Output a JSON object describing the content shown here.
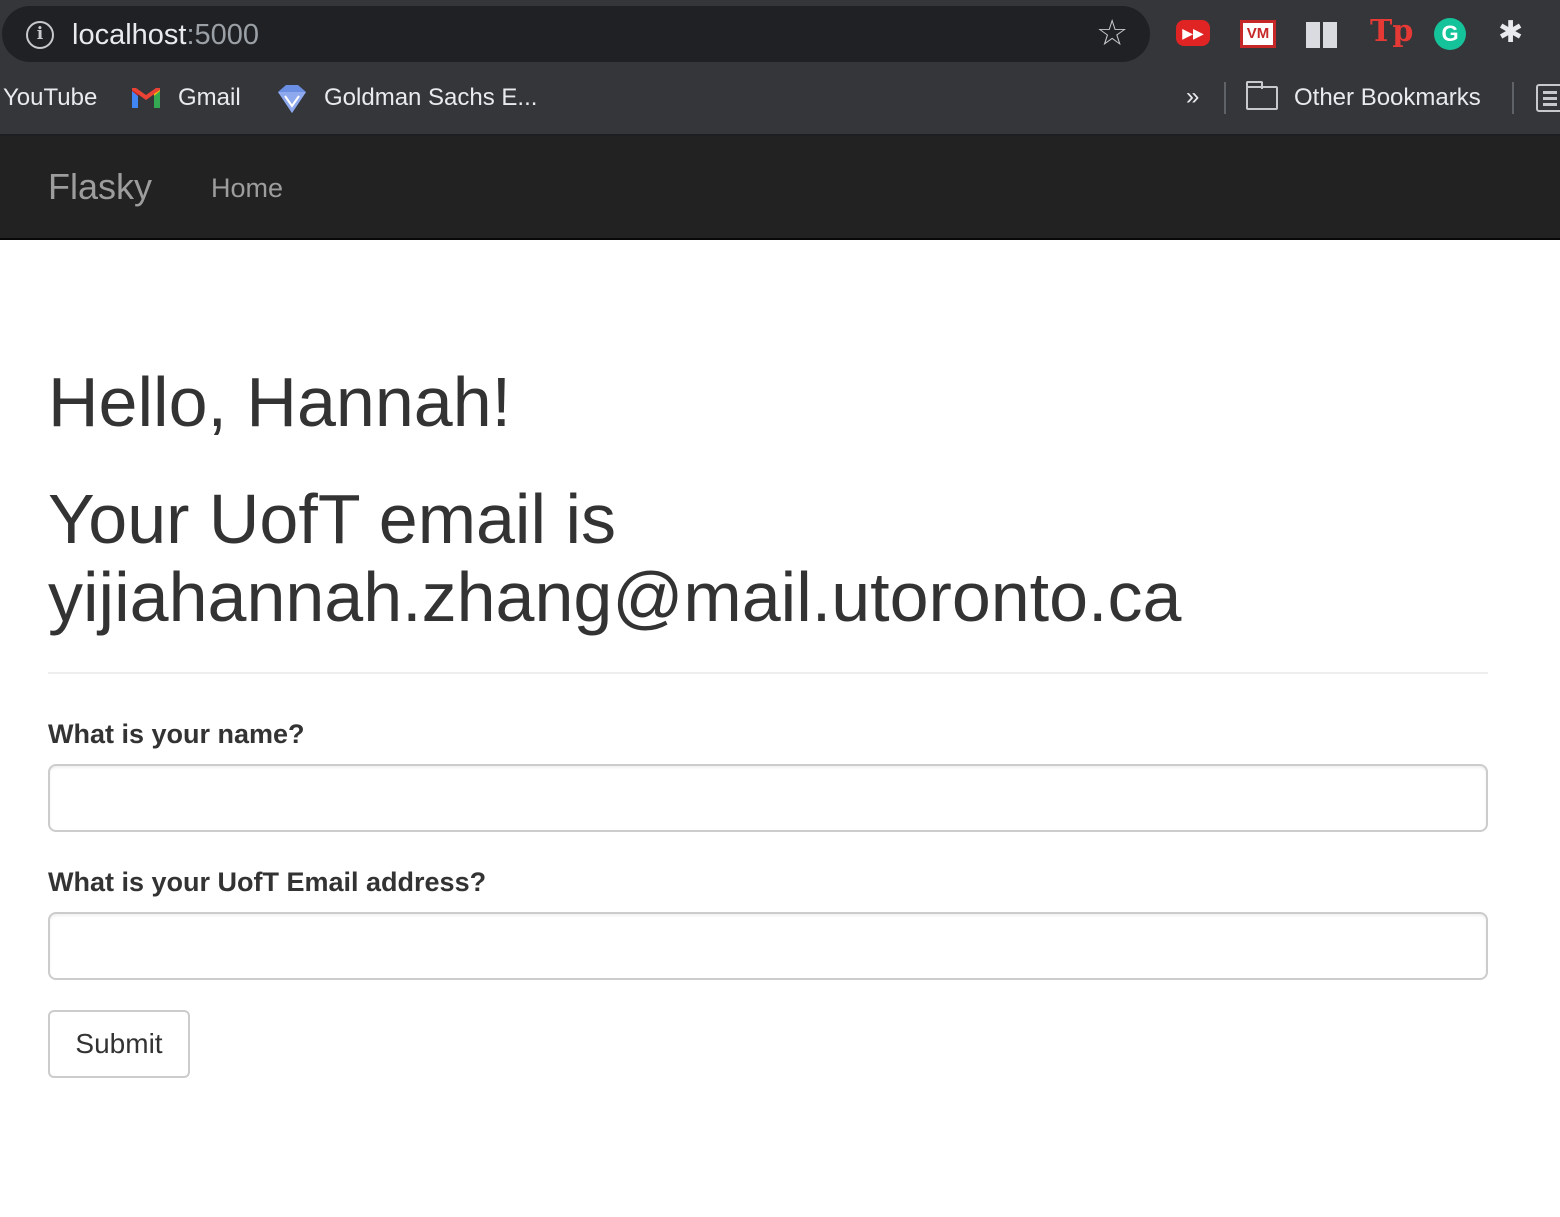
{
  "browser": {
    "url_host": "localhost",
    "url_port": ":5000",
    "bookmarks": {
      "youtube": "YouTube",
      "gmail": "Gmail",
      "goldman": "Goldman Sachs E...",
      "overflow": "»",
      "other": "Other Bookmarks"
    },
    "extensions": {
      "vm": "VM",
      "tp": "Tp",
      "grammarly": "G"
    }
  },
  "navbar": {
    "brand": "Flasky",
    "home": "Home"
  },
  "page": {
    "greeting": "Hello, Hannah!",
    "email_line": "Your UofT email is yijiahannah.zhang@mail.utoronto.ca"
  },
  "form": {
    "name_label": "What is your name?",
    "name_value": "",
    "email_label": "What is your UofT Email address?",
    "email_value": "",
    "submit_label": "Submit"
  },
  "colors": {
    "chrome_bg": "#35363a",
    "omnibox_bg": "#202124",
    "navbar_bg": "#222222",
    "navbar_text": "#9d9d9d",
    "heading_text": "#333333"
  }
}
